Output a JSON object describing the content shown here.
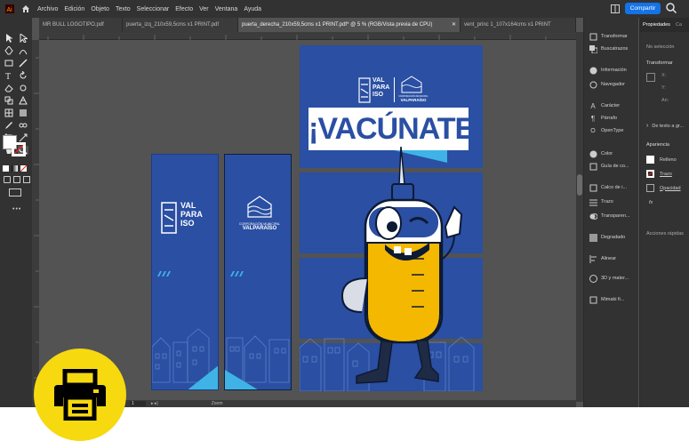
{
  "menubar": {
    "items": [
      "Archivo",
      "Edición",
      "Objeto",
      "Texto",
      "Seleccionar",
      "Efecto",
      "Ver",
      "Ventana",
      "Ayuda"
    ],
    "share_label": "Compartir"
  },
  "tabs": [
    {
      "label": "MR BULL LOGOTIPO.pdf",
      "active": false
    },
    {
      "label": "puerta_izq_210x59,5cms x1 PRINT.pdf",
      "active": false
    },
    {
      "label": "puerta_derecha_210x59,5cms x1 PRINT.pdf* @ 5 % (RGB/Vista previa de CPU)",
      "active": true
    },
    {
      "label": "vent_princ 1_107x164cms x1 PRINT",
      "active": false
    }
  ],
  "artwork": {
    "banner_text": "¡VACÚNATE!",
    "logo_text": [
      "VAL",
      "PARA",
      "ISO"
    ],
    "municipal_text": [
      "CORPORACIÓN MUNICIPAL",
      "VALPARAÍSO"
    ],
    "colors": {
      "blue": "#2a4fa3",
      "light_blue": "#3fb3e6",
      "yellow": "#f5b800"
    }
  },
  "panels": {
    "strip": [
      "Transformar",
      "Buscatrazos",
      "Información",
      "Navegador",
      "Carácter",
      "Párrafo",
      "OpenType",
      "Color",
      "Guía de co...",
      "Calco de i...",
      "Trazo",
      "Transparen...",
      "Degradado",
      "Alinear",
      "3D y mater...",
      "Mimaki fi..."
    ],
    "properties": {
      "tabs": [
        "Propiedades",
        "Ca"
      ],
      "no_selection": "No selección",
      "transform": "Transformar",
      "text_row": "De texto a gr...",
      "appearance": "Apariencia",
      "fill": "Relleno",
      "stroke": "Trazo",
      "opacity": "Opacidad",
      "fx": "fx",
      "quick_actions": "Acciones rápidas"
    }
  },
  "status": {
    "zoom": "1",
    "tool": "Zoom"
  }
}
